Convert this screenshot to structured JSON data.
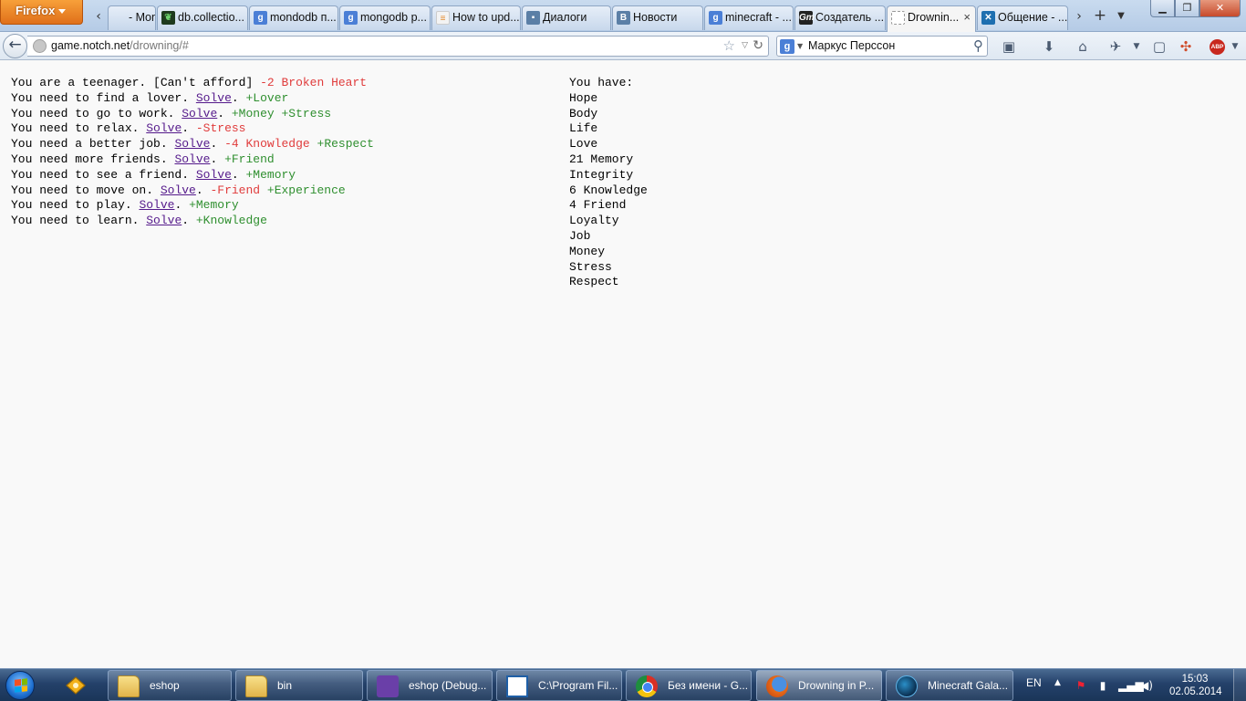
{
  "browser": {
    "menu_label": "Firefox",
    "tabs": [
      {
        "title": "- Mong...",
        "icon": "partial-page-icon",
        "active": false
      },
      {
        "title": "db.collectio...",
        "icon": "mongodb-leaf-icon",
        "active": false
      },
      {
        "title": "mondodb п...",
        "icon": "google-icon",
        "active": false
      },
      {
        "title": "mongodb p...",
        "icon": "google-icon",
        "active": false
      },
      {
        "title": "How to upd...",
        "icon": "stackoverflow-icon",
        "active": false
      },
      {
        "title": "Диалоги",
        "icon": "vk-dialog-icon",
        "active": false
      },
      {
        "title": "Новости",
        "icon": "vk-icon",
        "active": false
      },
      {
        "title": "minecraft - ...",
        "icon": "google-icon",
        "active": false
      },
      {
        "title": "Создатель ...",
        "icon": "gm-icon",
        "active": false
      },
      {
        "title": "Drownin...",
        "icon": "blank-page-icon",
        "active": true
      },
      {
        "title": "Общение - ...",
        "icon": "minecraft-forum-icon",
        "active": false
      }
    ],
    "url_host": "game.notch.net",
    "url_path": "/drowning/#",
    "search_text": "Маркус Перссон",
    "abp_label": "ABP"
  },
  "game": {
    "tasks": [
      {
        "text": "You are a teenager. [Can't afford]",
        "solve": "",
        "effects": [
          {
            "text": "-2 Broken Heart",
            "kind": "neg"
          }
        ]
      },
      {
        "text": "You need to find a lover.",
        "solve": "Solve",
        "effects": [
          {
            "text": "+Lover",
            "kind": "pos"
          }
        ]
      },
      {
        "text": "You need to go to work.",
        "solve": "Solve",
        "effects": [
          {
            "text": "+Money",
            "kind": "pos"
          },
          {
            "text": "+Stress",
            "kind": "pos"
          }
        ]
      },
      {
        "text": "You need to relax.",
        "solve": "Solve",
        "effects": [
          {
            "text": "-Stress",
            "kind": "neg"
          }
        ]
      },
      {
        "text": "You need a better job.",
        "solve": "Solve",
        "effects": [
          {
            "text": "-4 Knowledge",
            "kind": "neg"
          },
          {
            "text": "+Respect",
            "kind": "pos"
          }
        ]
      },
      {
        "text": "You need more friends.",
        "solve": "Solve",
        "effects": [
          {
            "text": "+Friend",
            "kind": "pos"
          }
        ]
      },
      {
        "text": "You need to see a friend.",
        "solve": "Solve",
        "effects": [
          {
            "text": "+Memory",
            "kind": "pos"
          }
        ]
      },
      {
        "text": "You need to move on.",
        "solve": "Solve",
        "effects": [
          {
            "text": "-Friend",
            "kind": "neg"
          },
          {
            "text": "+Experience",
            "kind": "pos"
          }
        ]
      },
      {
        "text": "You need to play.",
        "solve": "Solve",
        "effects": [
          {
            "text": "+Memory",
            "kind": "pos"
          }
        ]
      },
      {
        "text": "You need to learn.",
        "solve": "Solve",
        "effects": [
          {
            "text": "+Knowledge",
            "kind": "pos"
          }
        ]
      }
    ],
    "inventory_title": "You have:",
    "inventory": [
      "Hope",
      "Body",
      "Life",
      "Love",
      "21 Memory",
      "Integrity",
      "6 Knowledge",
      "4 Friend",
      "Loyalty",
      "Job",
      "Money",
      "Stress",
      "Respect"
    ],
    "colors": {
      "negative": "#e03c3c",
      "positive": "#2f8f2f",
      "link": "#551a8b"
    }
  },
  "taskbar": {
    "items": [
      {
        "label": "eshop",
        "icon": "folder-icon"
      },
      {
        "label": "bin",
        "icon": "folder-icon"
      },
      {
        "label": "eshop (Debug...",
        "icon": "visual-studio-icon"
      },
      {
        "label": "C:\\Program Fil...",
        "icon": "console-window-icon"
      },
      {
        "label": "Без имени - G...",
        "icon": "chrome-icon"
      },
      {
        "label": "Drowning in P...",
        "icon": "firefox-icon"
      },
      {
        "label": "Minecraft Gala...",
        "icon": "minecraft-launcher-icon"
      }
    ],
    "language": "EN",
    "time": "15:03",
    "date": "02.05.2014"
  }
}
